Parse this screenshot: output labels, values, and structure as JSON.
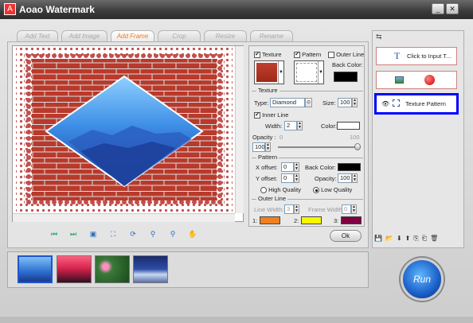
{
  "window": {
    "title": "Aoao Watermark",
    "logo_glyph": "A"
  },
  "tabs": [
    {
      "label": "Add Text",
      "active": false
    },
    {
      "label": "Add Image",
      "active": false
    },
    {
      "label": "Add Frame",
      "active": true
    },
    {
      "label": "Crop",
      "active": false
    },
    {
      "label": "Resize",
      "active": false
    },
    {
      "label": "Rename",
      "active": false
    }
  ],
  "frame_options": {
    "texture": {
      "label": "Texture",
      "checked": true
    },
    "pattern": {
      "label": "Pattern",
      "checked": true
    },
    "outer_line": {
      "label": "Outer Line",
      "checked": false
    },
    "back_color_label": "Back Color:",
    "back_color": "#000000"
  },
  "texture_section": {
    "title": "Texture",
    "type_label": "Type:",
    "type_value": "Diamond",
    "size_label": "Size:",
    "size_value": "100",
    "inner_line": {
      "label": "Inner Line",
      "checked": true
    },
    "width_label": "Width:",
    "width_value": "2",
    "color_label": "Color:",
    "color_value": "#ffffff",
    "opacity_label": "Opacity :",
    "opacity_min": "0",
    "opacity_max": "100",
    "opacity_value": "100"
  },
  "pattern_section": {
    "title": "Pattern",
    "x_offset_label": "X offset:",
    "x_offset_value": "0",
    "y_offset_label": "Y offset:",
    "y_offset_value": "0",
    "back_color_label": "Back Color:",
    "back_color": "#000000",
    "opacity_label": "Opacity:",
    "opacity_value": "100",
    "quality_options": [
      {
        "label": "High Quality",
        "selected": false
      },
      {
        "label": "Low Quality",
        "selected": true
      }
    ]
  },
  "outer_line_section": {
    "title": "Outer Line",
    "line_width_label": "Line Width:",
    "line_width_value": "3",
    "frame_width_label": "Frame Width:",
    "frame_width_value": "0",
    "colors": [
      {
        "label": "1:",
        "color": "#f08020"
      },
      {
        "label": "2:",
        "color": "#f7f700"
      },
      {
        "label": "3:",
        "color": "#800040"
      }
    ]
  },
  "ok_label": "Ok",
  "toolbar_icons": [
    "first-icon",
    "last-icon",
    "fit-icon",
    "actual-size-icon",
    "rotate-icon",
    "zoom-in-icon",
    "zoom-out-icon",
    "pan-hand-icon"
  ],
  "layers": [
    {
      "label": "Click to Input T...",
      "icon": "text-t-icon"
    },
    {
      "label": "",
      "icon": "image-icon"
    },
    {
      "label": "Texture Pattern",
      "icon": "frame-icon"
    }
  ],
  "layer_toolbar_icons": [
    "save-icon",
    "open-icon",
    "move-down-icon",
    "move-up-icon",
    "import-icon",
    "export-icon",
    "delete-icon"
  ],
  "run_label": "Run",
  "colors": {
    "accent_tab": "#f07a1a",
    "selected_layer_border": "#0000ff",
    "brick": "#b83a2c"
  }
}
